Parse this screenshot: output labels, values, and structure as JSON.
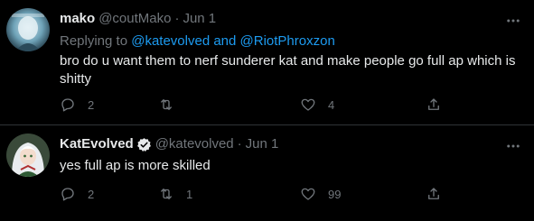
{
  "tweets": [
    {
      "name": "mako",
      "handle": "@coutMako",
      "separator": "·",
      "date": "Jun 1",
      "replying_prefix": "Replying to",
      "replying_to": "@katevolved and @RiotPhroxzon",
      "text": "bro do u want them to nerf sunderer kat and make people go full ap which is shitty",
      "reply_count": "2",
      "retweet_count": "",
      "like_count": "4",
      "verified": false
    },
    {
      "name": "KatEvolved",
      "handle": "@katevolved",
      "separator": "·",
      "date": "Jun 1",
      "text": "yes full ap is more skilled",
      "reply_count": "2",
      "retweet_count": "1",
      "like_count": "99",
      "verified": true
    }
  ],
  "icons": {
    "more": "more-horizontal-icon",
    "reply": "reply-icon",
    "retweet": "retweet-icon",
    "like": "heart-icon",
    "share": "share-icon",
    "verified": "verified-badge-icon"
  },
  "colors": {
    "background": "#000000",
    "primary_text": "#e7e9ea",
    "secondary_text": "#71767b",
    "link": "#1d9bf0",
    "divider": "#2f3336"
  }
}
